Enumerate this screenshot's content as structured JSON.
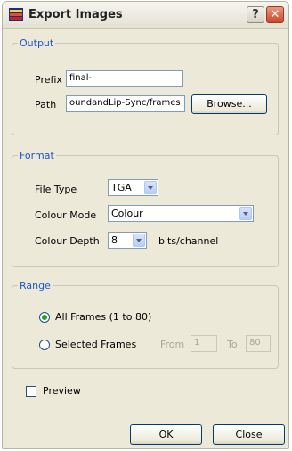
{
  "window": {
    "title": "Export Images",
    "help_glyph": "?",
    "close_glyph": "✕"
  },
  "output": {
    "legend": "Output",
    "prefix_label": "Prefix",
    "prefix_value": "final-",
    "path_label": "Path",
    "path_value": "oundandLip-Sync/frames",
    "browse_label": "Browse..."
  },
  "format": {
    "legend": "Format",
    "file_type_label": "File Type",
    "file_type_value": "TGA",
    "colour_mode_label": "Colour Mode",
    "colour_mode_value": "Colour",
    "colour_depth_label": "Colour Depth",
    "colour_depth_value": "8",
    "bits_label": "bits/channel"
  },
  "range": {
    "legend": "Range",
    "all_frames_label": "All Frames (1 to 80)",
    "all_frames_selected": true,
    "selected_frames_label": "Selected Frames",
    "from_label": "From",
    "from_value": "1",
    "to_label": "To",
    "to_value": "80"
  },
  "preview": {
    "label": "Preview",
    "checked": false
  },
  "buttons": {
    "ok_label": "OK",
    "close_label": "Close"
  }
}
